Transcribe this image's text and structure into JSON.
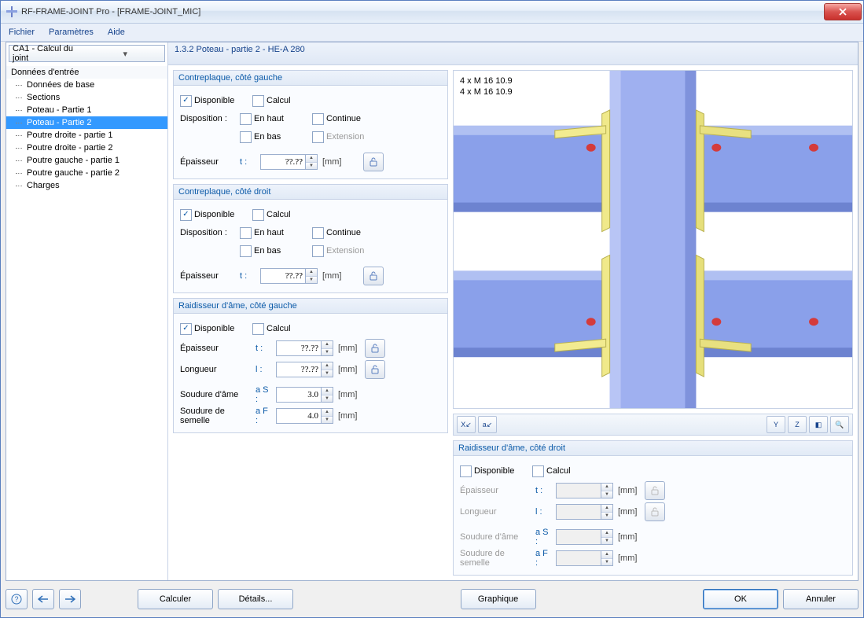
{
  "window": {
    "title": "RF-FRAME-JOINT Pro - [FRAME-JOINT_MIC]"
  },
  "menu": {
    "file": "Fichier",
    "params": "Paramètres",
    "help": "Aide"
  },
  "sidebar": {
    "combo": "CA1 - Calcul du joint",
    "root": "Données d'entrée",
    "items": [
      "Données de base",
      "Sections",
      "Poteau - Partie 1",
      "Poteau - Partie 2",
      "Poutre droite - partie 1",
      "Poutre droite - partie 2",
      "Poutre gauche - partie 1",
      "Poutre gauche - partie 2",
      "Charges"
    ],
    "selected": 3
  },
  "main_title": "1.3.2 Poteau - partie 2 - HE-A 280",
  "labels": {
    "disponible": "Disponible",
    "calcul": "Calcul",
    "disposition": "Disposition :",
    "en_haut": "En haut",
    "en_bas": "En bas",
    "continue": "Continue",
    "extension": "Extension",
    "epaisseur": "Épaisseur",
    "longueur": "Longueur",
    "soudure_ame": "Soudure d'âme",
    "soudure_semelle": "Soudure de semelle",
    "mm": "[mm]",
    "t": "t :",
    "l": "l :",
    "as": "a S :",
    "af": "a F :"
  },
  "panels": {
    "cp_gauche": {
      "title": "Contreplaque, côté gauche",
      "disponible": true,
      "calcul": false,
      "en_haut": false,
      "en_bas": false,
      "continue": false,
      "extension": false,
      "t": "??.??"
    },
    "cp_droit": {
      "title": "Contreplaque, côté droit",
      "disponible": true,
      "calcul": false,
      "en_haut": false,
      "en_bas": false,
      "continue": false,
      "extension": false,
      "t": "??.??"
    },
    "ra_gauche": {
      "title": "Raidisseur d'âme, côté gauche",
      "disponible": true,
      "calcul": false,
      "t": "??.??",
      "l": "??.??",
      "as": "3.0",
      "af": "4.0"
    },
    "ra_droit": {
      "title": "Raidisseur d'âme, côté droit",
      "disponible": false,
      "calcul": false,
      "t": "",
      "l": "",
      "as": "",
      "af": ""
    }
  },
  "viewport": {
    "label1": "4 x M 16 10.9",
    "label2": "4 x M 16 10.9"
  },
  "footer": {
    "calculer": "Calculer",
    "details": "Détails...",
    "graphique": "Graphique",
    "ok": "OK",
    "annuler": "Annuler"
  }
}
